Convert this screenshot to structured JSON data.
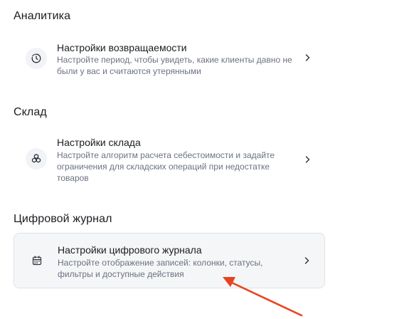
{
  "sections": [
    {
      "title": "Аналитика",
      "card": {
        "title": "Настройки возвращаемости",
        "description": "Настройте период, чтобы увидеть, какие клиенты давно не были у вас и считаются утерянными",
        "icon": "clock-dashed-icon"
      }
    },
    {
      "title": "Склад",
      "card": {
        "title": "Настройки склада",
        "description": "Настройте алгоритм расчета себестоимости и задайте ограничения для складских операций при недостатке товаров",
        "icon": "boxes-stack-icon"
      }
    },
    {
      "title": "Цифровой журнал",
      "card": {
        "title": "Настройки цифрового журнала",
        "description": "Настройте отображение записей: колонки, статусы, фильтры и доступные действия",
        "icon": "calendar-icon"
      }
    }
  ],
  "colors": {
    "annotation_arrow": "#e8431e",
    "active_card_bg": "#f5f6f8",
    "muted_text": "#6b7280"
  }
}
